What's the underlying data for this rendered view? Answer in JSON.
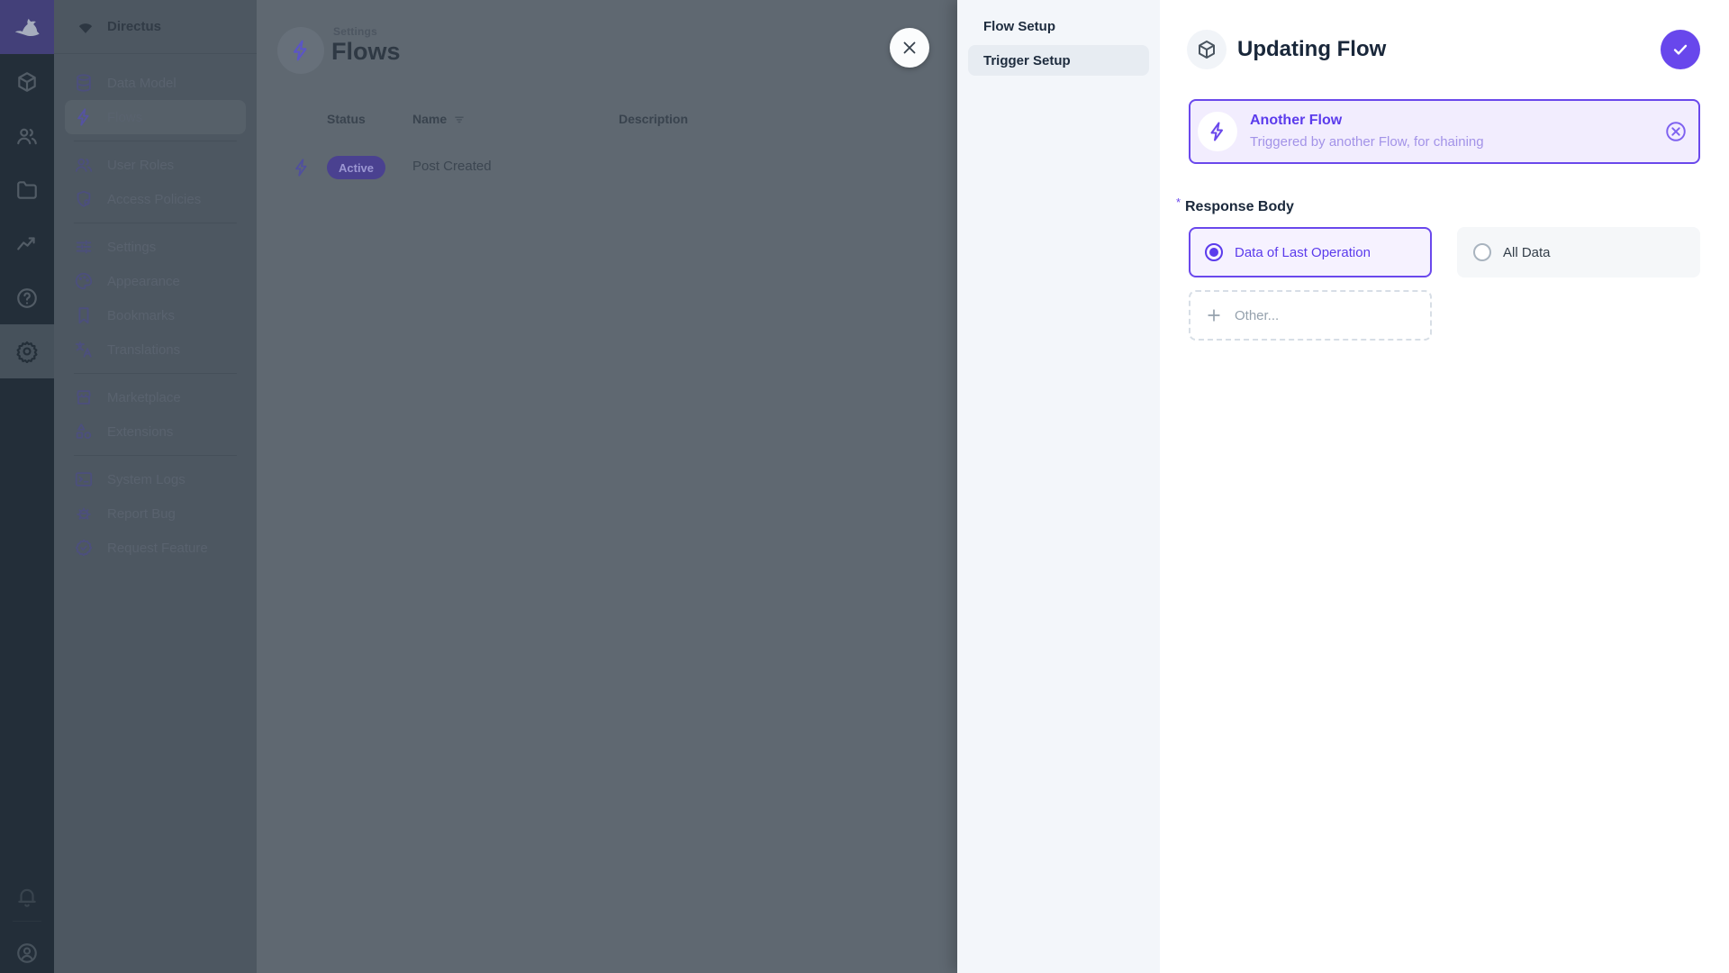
{
  "colors": {
    "accent": "#6644e9",
    "accent_light_bg": "#f2edfe",
    "drawer_nav_bg": "#f3f6fa",
    "status_active_bg": "#6644e9"
  },
  "module_bar": {
    "logo_icon": "rabbit-logo-icon",
    "modules": [
      {
        "icon": "box-icon"
      },
      {
        "icon": "users-icon"
      },
      {
        "icon": "folder-icon"
      },
      {
        "icon": "activity-icon"
      },
      {
        "icon": "help-icon"
      },
      {
        "icon": "gear-icon",
        "active": true
      }
    ],
    "bottom_icons": [
      "bell-icon",
      "user-circle-icon"
    ]
  },
  "sidebar": {
    "project_name": "Directus",
    "project_icon": "signal-icon",
    "items": [
      {
        "label": "Data Model",
        "icon": "database-icon"
      },
      {
        "label": "Flows",
        "icon": "bolt-icon",
        "active": true
      },
      {
        "label": "User Roles",
        "icon": "users-icon"
      },
      {
        "label": "Access Policies",
        "icon": "shield-badge-icon"
      },
      {
        "label": "Settings",
        "icon": "tune-icon"
      },
      {
        "label": "Appearance",
        "icon": "palette-icon"
      },
      {
        "label": "Bookmarks",
        "icon": "bookmark-icon"
      },
      {
        "label": "Translations",
        "icon": "translate-icon"
      },
      {
        "label": "Marketplace",
        "icon": "storefront-icon"
      },
      {
        "label": "Extensions",
        "icon": "shapes-icon"
      },
      {
        "label": "System Logs",
        "icon": "terminal-icon"
      },
      {
        "label": "Report Bug",
        "icon": "bug-icon"
      },
      {
        "label": "Request Feature",
        "icon": "badge-check-icon"
      }
    ]
  },
  "main": {
    "breadcrumb": "Settings",
    "title": "Flows",
    "table": {
      "columns": [
        "Status",
        "Name",
        "Description"
      ],
      "rows": [
        {
          "status": "Active",
          "name": "Post Created",
          "description": ""
        }
      ]
    }
  },
  "drawer": {
    "nav": [
      {
        "label": "Flow Setup"
      },
      {
        "label": "Trigger Setup",
        "active": true
      }
    ],
    "title": "Updating Flow",
    "title_icon": "package-icon",
    "save_icon": "check-icon",
    "trigger_card": {
      "icon": "bolt-icon",
      "title": "Another Flow",
      "subtitle": "Triggered by another Flow, for chaining",
      "remove_icon": "x-circle-icon"
    },
    "response_body": {
      "label": "Response Body",
      "required_marker": "*",
      "options": [
        {
          "label": "Data of Last Operation",
          "selected": true
        },
        {
          "label": "All Data",
          "selected": false
        }
      ],
      "other_label": "Other..."
    }
  }
}
